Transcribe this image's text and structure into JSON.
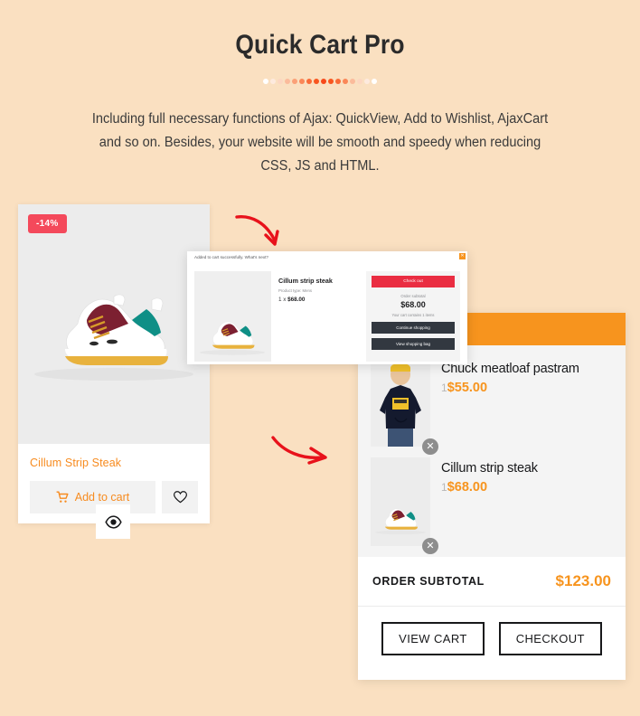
{
  "header": {
    "title": "Quick Cart Pro",
    "subtitle": "Including full necessary functions of Ajax: QuickView, Add to Wishlist, AjaxCart and so on. Besides, your website will be smooth and speedy when reducing CSS, JS and HTML.",
    "dot_colors": [
      "#ffffff",
      "#fdeade",
      "#fcd6c1",
      "#fbbb9b",
      "#fba077",
      "#fa8758",
      "#f96b38",
      "#f85620",
      "#f7491a",
      "#f85620",
      "#f96b38",
      "#fa8758",
      "#fbbb9b",
      "#fcd6c1",
      "#fdeade",
      "#ffffff"
    ]
  },
  "product_card": {
    "badge": "-14%",
    "name": "Cillum Strip Steak",
    "add_to_cart_label": "Add to cart",
    "cart_icon": "shopping-cart-icon",
    "wishlist_icon": "heart-icon",
    "quickview_icon": "eye-icon",
    "image_alt": "chunky sneaker"
  },
  "modal": {
    "heading": "Added to cart successfully. What's next?",
    "close_icon": "close-icon",
    "product_name": "Cillum strip steak",
    "product_type": "Product type: Mens",
    "quantity_line_prefix": "1 x ",
    "quantity_line_price": "$68.00",
    "checkout_label": "Check out",
    "subtotal_label": "Order subtotal",
    "subtotal_value": "$68.00",
    "cart_note": "Your cart contains 1 items",
    "continue_label": "Continue shopping",
    "view_bag_label": "View shopping bag"
  },
  "cart_panel": {
    "header_color": "#f7941e",
    "items": [
      {
        "name": "Chuck meatloaf pastram",
        "qty": "1",
        "price": "$55.00",
        "remove_icon": "close-circle-icon",
        "image_alt": "man in navy t-shirt and yellow beanie"
      },
      {
        "name": "Cillum strip steak",
        "qty": "1",
        "price": "$68.00",
        "remove_icon": "close-circle-icon",
        "image_alt": "chunky sneaker pair"
      }
    ],
    "subtotal_label": "ORDER SUBTOTAL",
    "subtotal_value": "$123.00",
    "view_cart_label": "VIEW CART",
    "checkout_label": "CHECKOUT"
  },
  "annotations": {
    "arrow_1": "curved-arrow-down-right",
    "arrow_2": "curved-arrow-right",
    "arrow_color": "#e8121b"
  }
}
